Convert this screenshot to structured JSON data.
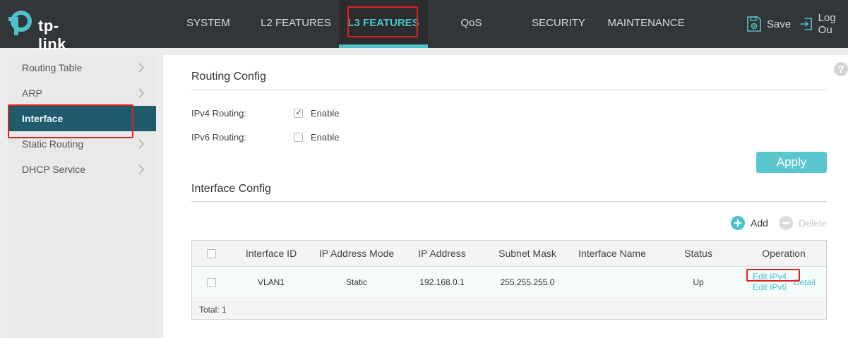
{
  "brand": {
    "logo_text": "tp-link"
  },
  "nav": {
    "tabs": [
      {
        "label": "SYSTEM"
      },
      {
        "label": "L2 FEATURES"
      },
      {
        "label": "L3 FEATURES"
      },
      {
        "label": "QoS"
      },
      {
        "label": "SECURITY"
      },
      {
        "label": "MAINTENANCE"
      }
    ],
    "active_tab": "L3 FEATURES",
    "save_label": "Save",
    "logout_label": "Log Ou"
  },
  "sidebar": {
    "items": [
      {
        "label": "Routing Table"
      },
      {
        "label": "ARP"
      },
      {
        "label": "Interface"
      },
      {
        "label": "Static Routing"
      },
      {
        "label": "DHCP Service"
      }
    ],
    "active_item": "Interface"
  },
  "routing_config": {
    "title": "Routing Config",
    "ipv4_label": "IPv4 Routing:",
    "ipv4_enable_label": "Enable",
    "ipv4_enabled": true,
    "ipv6_label": "IPv6 Routing:",
    "ipv6_enable_label": "Enable",
    "ipv6_enabled": false,
    "apply_label": "Apply"
  },
  "interface_config": {
    "title": "Interface Config",
    "add_label": "Add",
    "delete_label": "Delete",
    "columns": [
      "Interface ID",
      "IP Address Mode",
      "IP Address",
      "Subnet Mask",
      "Interface Name",
      "Status",
      "Operation"
    ],
    "rows": [
      {
        "interface_id": "VLAN1",
        "ip_mode": "Static",
        "ip_address": "192.168.0.1",
        "subnet_mask": "255.255.255.0",
        "interface_name": "",
        "status": "Up",
        "ops": {
          "edit_ipv4": "Edit IPv4",
          "edit_ipv6": "Edit IPv6",
          "detail": "Detail"
        }
      }
    ],
    "total_label": "Total: 1"
  },
  "colors": {
    "accent": "#4dc2cc",
    "topbar": "#333638",
    "sidebar_active": "#1f5b6b",
    "highlight": "#e02020"
  },
  "help_icon_text": "?"
}
